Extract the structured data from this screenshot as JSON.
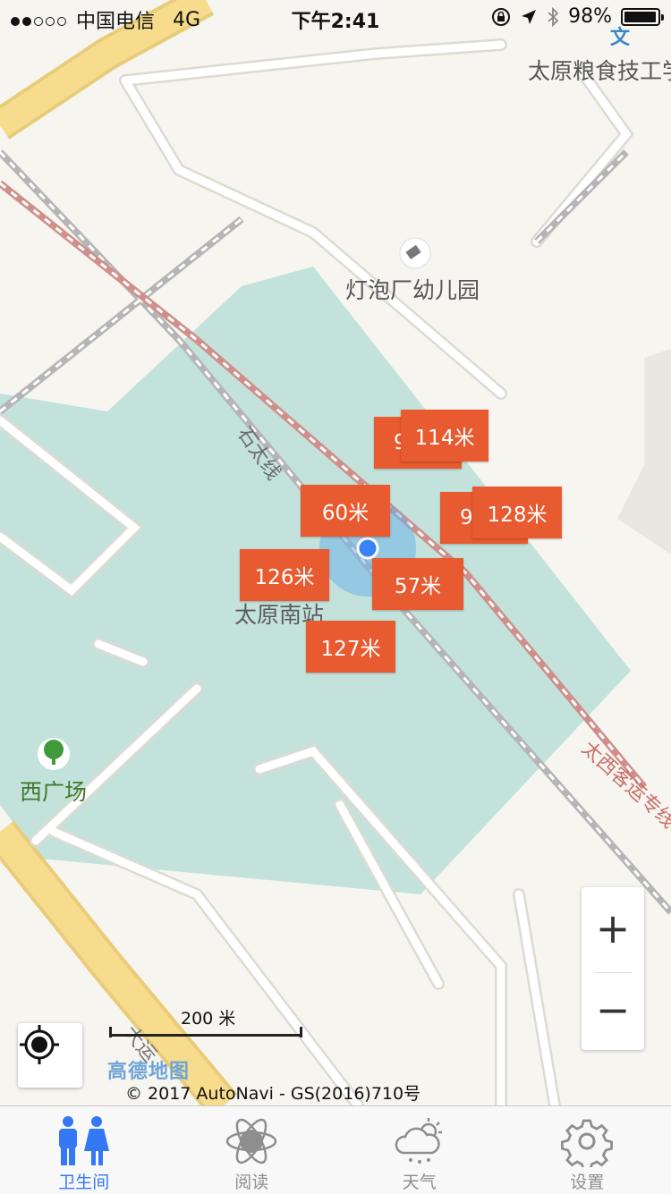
{
  "status_bar": {
    "carrier": "中国电信",
    "network": "4G",
    "time": "下午2:41",
    "battery": "98%"
  },
  "map": {
    "pois": {
      "top_right": "太原粮食技工学",
      "top_right_glyph": "文",
      "kindergarten": "灯泡厂幼儿园",
      "station": "太原南站",
      "west_square": "西广场",
      "rail_line_1": "石太线",
      "rail_line_2": "太西客运专线",
      "road_label": "大运"
    },
    "markers": [
      {
        "label": "9",
        "id": "m1"
      },
      {
        "label": "114米",
        "id": "m2"
      },
      {
        "label": "60米",
        "id": "m3"
      },
      {
        "label": "9",
        "id": "m4"
      },
      {
        "label": "128米",
        "id": "m5"
      },
      {
        "label": "126米",
        "id": "m6"
      },
      {
        "label": "57米",
        "id": "m7"
      },
      {
        "label": "127米",
        "id": "m8"
      }
    ],
    "scale_label": "200 米",
    "provider_logo": "高德地图",
    "copyright": "© 2017 AutoNavi - GS(2016)710号",
    "zoom_in": "+",
    "zoom_out": "−",
    "colors": {
      "station_area": "#c3e2dc",
      "marker": "#e85a30",
      "location_dot": "#3b82f6"
    }
  },
  "tabbar": {
    "items": [
      {
        "label": "卫生间",
        "icon": "restroom-icon",
        "active": true
      },
      {
        "label": "阅读",
        "icon": "atom-reading-icon",
        "active": false
      },
      {
        "label": "天气",
        "icon": "cloud-sun-icon",
        "active": false
      },
      {
        "label": "设置",
        "icon": "gear-icon",
        "active": false
      }
    ],
    "active_color": "#3478f6"
  }
}
